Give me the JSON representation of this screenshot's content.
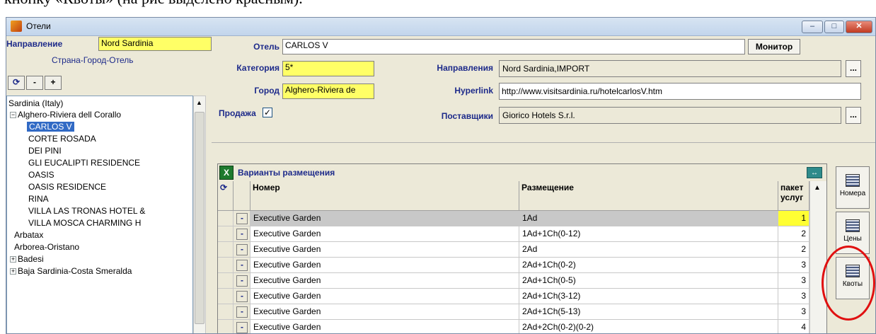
{
  "window": {
    "title": "Отели"
  },
  "left": {
    "direction_label": "Направление",
    "direction_value": "Nord Sardinia",
    "tree_header": "Страна-Город-Отель",
    "toolbar": {
      "minus": "-",
      "plus": "+"
    },
    "tree": {
      "root": "Sardinia (Italy)",
      "city": "Alghero-Riviera dell Corallo",
      "hotels": [
        "CARLOS V",
        "CORTE ROSADA",
        "DEI PINI",
        "GLI EUCALIPTI RESIDENCE",
        "OASIS",
        "OASIS RESIDENCE",
        "RINA",
        "VILLA LAS TRONAS HOTEL &",
        "VILLA MOSCA CHARMING H"
      ],
      "others": [
        "Arbatax",
        "Arborea-Oristano",
        "Badesi",
        "Baja Sardinia-Costa Smeralda"
      ]
    }
  },
  "right": {
    "hotel_label": "Отель",
    "hotel_value": "CARLOS V",
    "monitor_button": "Монитор",
    "category_label": "Категория",
    "category_value": "5*",
    "directions_label": "Направления",
    "directions_value": "Nord Sardinia,IMPORT",
    "city_label": "Город",
    "city_value": "Alghero-Riviera de",
    "hyperlink_label": "Hyperlink",
    "hyperlink_value": "http://www.visitsardinia.ru/hotelcarlosV.htm",
    "sale_label": "Продажа",
    "sale_checked": true,
    "suppliers_label": "Поставщики",
    "suppliers_value": "Giorico Hotels S.r.l.",
    "dots": "..."
  },
  "grid": {
    "title": "Варианты размещения",
    "columns": {
      "room": "Номер",
      "placement": "Размещение",
      "package": "пакет услуг"
    },
    "rows": [
      {
        "room": "Executive Garden",
        "placement": "1Ad",
        "num": "1"
      },
      {
        "room": "Executive Garden",
        "placement": "1Ad+1Ch(0-12)",
        "num": "2"
      },
      {
        "room": "Executive Garden",
        "placement": "2Ad",
        "num": "2"
      },
      {
        "room": "Executive Garden",
        "placement": "2Ad+1Ch(0-2)",
        "num": "3"
      },
      {
        "room": "Executive Garden",
        "placement": "2Ad+1Ch(0-5)",
        "num": "3"
      },
      {
        "room": "Executive Garden",
        "placement": "2Ad+1Ch(3-12)",
        "num": "3"
      },
      {
        "room": "Executive Garden",
        "placement": "2Ad+1Ch(5-13)",
        "num": "3"
      },
      {
        "room": "Executive Garden",
        "placement": "2Ad+2Ch(0-2)(0-2)",
        "num": "4"
      }
    ]
  },
  "side_buttons": {
    "rooms": "Номера",
    "prices": "Цены",
    "quotas": "Квоты"
  },
  "caption": "кнопку «Квоты» (на рис выделено красным)."
}
